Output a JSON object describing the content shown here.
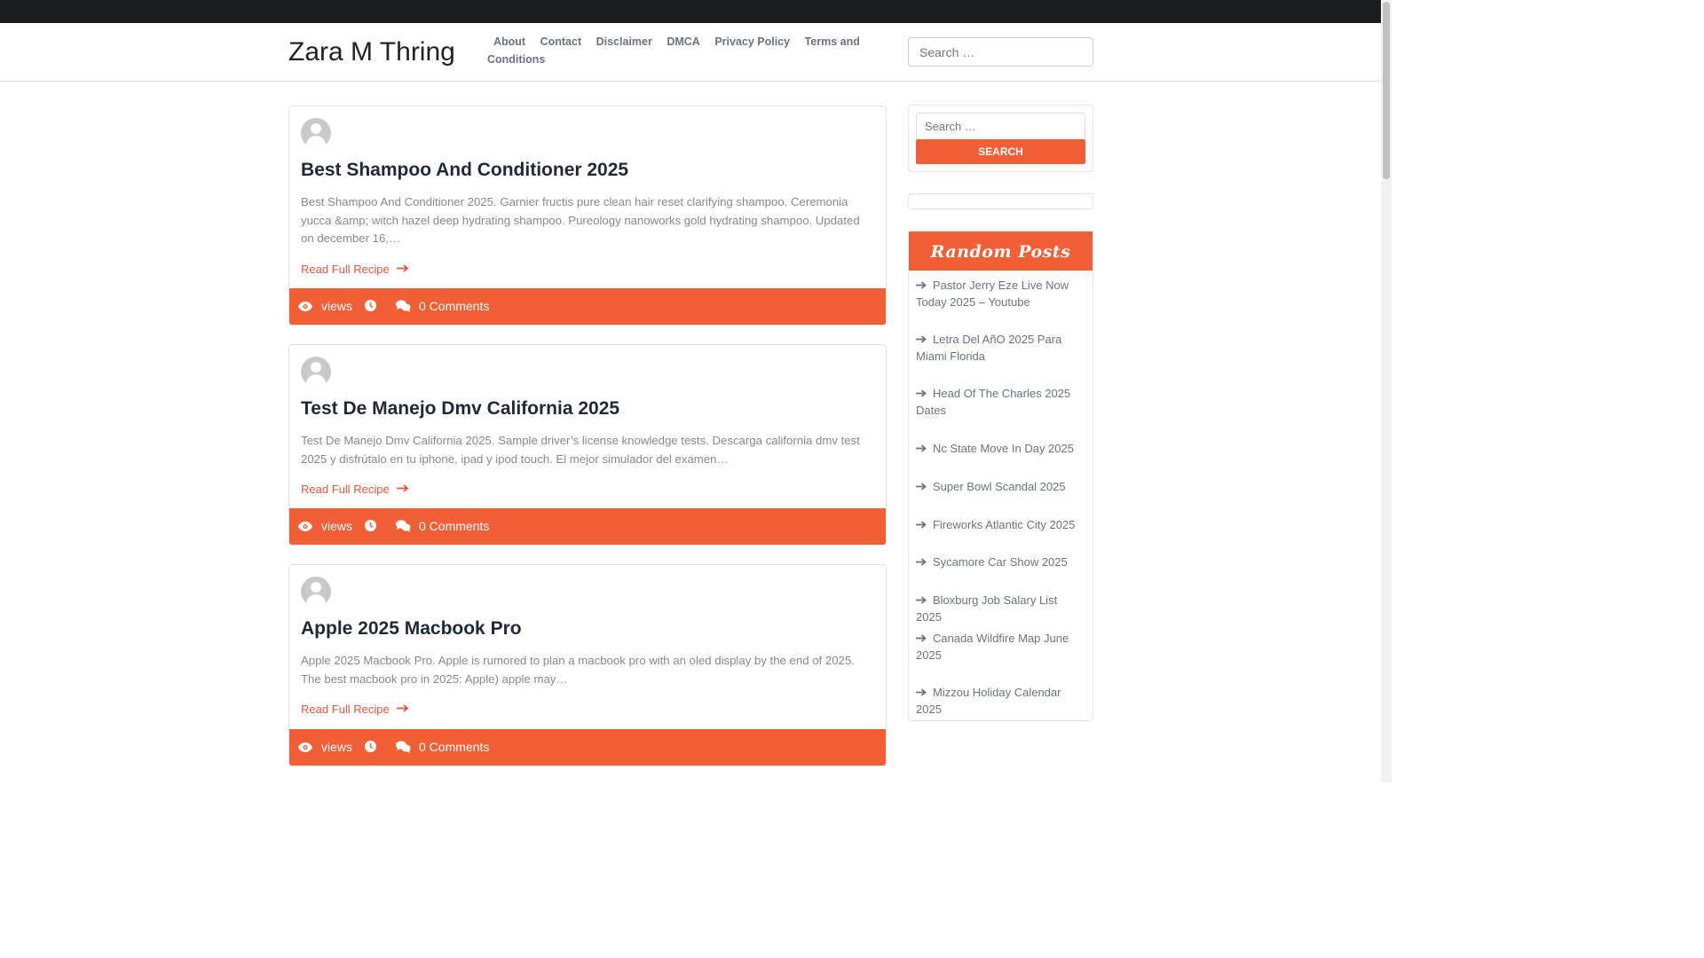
{
  "site": {
    "title": "Zara M Thring"
  },
  "nav": {
    "items": [
      {
        "label": "About"
      },
      {
        "label": "Contact"
      },
      {
        "label": "Disclaimer"
      },
      {
        "label": "DMCA"
      },
      {
        "label": "Privacy Policy"
      },
      {
        "label": "Terms and Conditions"
      }
    ]
  },
  "header_search": {
    "placeholder": "Search …"
  },
  "posts": [
    {
      "title": "Best Shampoo And Conditioner 2025",
      "excerpt": "Best Shampoo And Conditioner 2025. Garnier fructis pure clean hair reset clarifying shampoo. Ceremonia yucca &amp; witch hazel deep hydrating shampoo. Pureology nanoworks gold hydrating shampoo. Updated on december 16,…",
      "read_more": "Read Full Recipe",
      "views_label": "views",
      "comments_label": "0 Comments"
    },
    {
      "title": "Test De Manejo Dmv California 2025",
      "excerpt": "Test De Manejo Dmv California 2025. Sample driver’s license knowledge tests. Descarga california dmv test 2025 y disfrútalo en tu iphone, ipad y ipod touch. El mejor simulador del examen…",
      "read_more": "Read Full Recipe",
      "views_label": "views",
      "comments_label": "0 Comments"
    },
    {
      "title": "Apple 2025 Macbook Pro",
      "excerpt": "Apple 2025 Macbook Pro. Apple is rumored to plan a macbook pro with an oled display by the end of 2025. The best macbook pro in 2025: Apple) apple may…",
      "read_more": "Read Full Recipe",
      "views_label": "views",
      "comments_label": "0 Comments"
    }
  ],
  "sidebar": {
    "search": {
      "placeholder": "Search …",
      "button": "Search"
    },
    "random_posts": {
      "heading": "Random Posts",
      "items": [
        "Pastor Jerry Eze Live Now Today 2025 – Youtube",
        "Letra Del AñO 2025 Para Miami Florida",
        "Head Of The Charles 2025 Dates",
        "Nc State Move In Day 2025",
        "Super Bowl Scandal 2025",
        "Fireworks Atlantic City 2025",
        "Sycamore Car Show 2025",
        "Bloxburg Job Salary List 2025",
        "Canada Wildfire Map June 2025",
        "Mizzou Holiday Calendar 2025"
      ]
    }
  },
  "colors": {
    "accent": "#f15f37",
    "topbar": "#1b1e21"
  },
  "icons": [
    "eye-icon",
    "clock-icon",
    "comments-icon",
    "arrow-right-icon",
    "avatar-icon"
  ]
}
